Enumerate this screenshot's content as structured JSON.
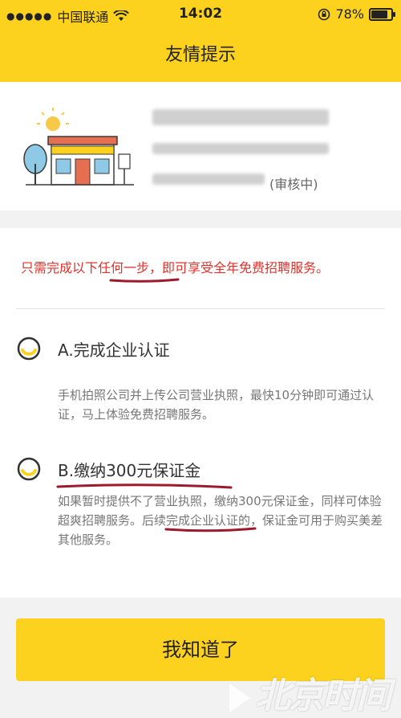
{
  "status_bar": {
    "signal_dots": "●●●●●",
    "carrier": "中国联通",
    "time": "14:02",
    "battery": "78%",
    "battery_level": 0.78
  },
  "nav": {
    "title": "友情提示"
  },
  "company": {
    "status": "(审核中)"
  },
  "notice": "只需完成以下任何一步，即可享受全年免费招聘服务。",
  "options": [
    {
      "heading": "A.完成企业认证",
      "desc": "手机拍照公司并上传公司营业执照，最快10分钟即可通过认证，马上体验免费招聘服务。"
    },
    {
      "heading": "B.缴纳300元保证金",
      "desc": "如果暂时提供不了营业执照，缴纳300元保证金，同样可体验超爽招聘服务。后续完成企业认证的，保证金可用于购买美差其他服务。"
    }
  ],
  "button": {
    "label": "我知道了"
  },
  "watermark": "北京时间",
  "colors": {
    "accent": "#fcd21f",
    "notice": "#e0302a",
    "annotation": "#9b1a2c"
  }
}
